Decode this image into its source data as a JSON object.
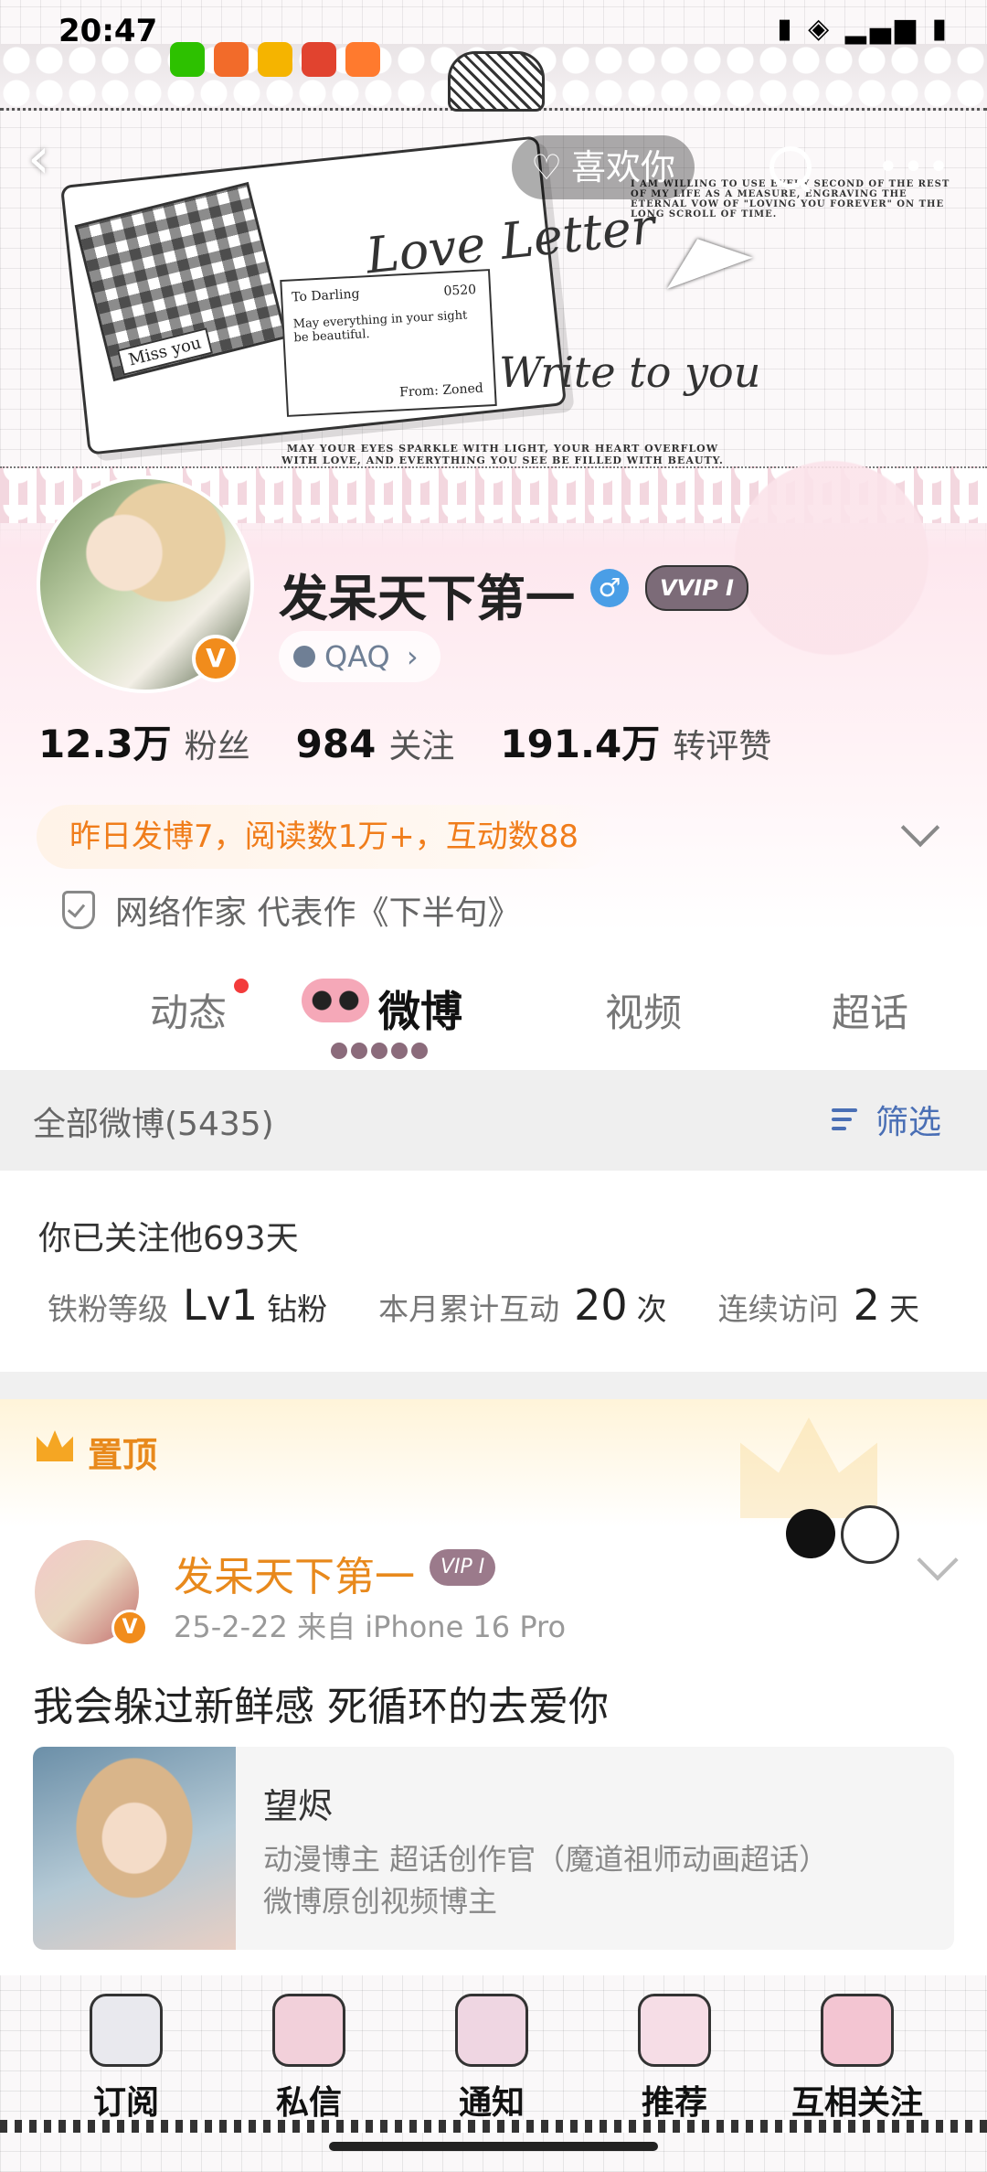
{
  "status_bar": {
    "time": "20:47",
    "system": "▮ ◈ ▂▄▆ ▮"
  },
  "header": {
    "like_label": "喜欢你",
    "banner": {
      "love_letter": "Love Letter",
      "write_to_you": "Write to you",
      "letter_to": "To Darling",
      "letter_date": "0520",
      "letter_body": "May everything in your sight be beautiful.",
      "letter_from": "From: Zoned",
      "miss_you": "Miss you",
      "slogan_bottom": "MAY YOUR EYES SPARKLE WITH LIGHT, YOUR HEART OVERFLOW WITH LOVE, AND EVERYTHING YOU SEE BE FILLED WITH BEAUTY.",
      "slogan_top": "I AM WILLING TO USE EVERY SECOND OF THE REST OF MY LIFE AS A MEASURE, ENGRAVING THE ETERNAL VOW OF \"LOVING YOU FOREVER\" ON THE LONG SCROLL OF TIME."
    }
  },
  "profile": {
    "nickname": "发呆天下第一",
    "gender_symbol": "♂",
    "vip_label": "VVIP I",
    "verify_badge": "V",
    "tag": "QAQ",
    "tag_arrow": "›",
    "stats": [
      {
        "value": "12.3万",
        "label": "粉丝"
      },
      {
        "value": "984",
        "label": "关注"
      },
      {
        "value": "191.4万",
        "label": "转评赞"
      }
    ],
    "activity": "昨日发博7，阅读数1万+，互动数88",
    "author_desc": "网络作家 代表作《下半句》"
  },
  "tabs": [
    {
      "label": "动态"
    },
    {
      "label": "微博"
    },
    {
      "label": "视频"
    },
    {
      "label": "超话"
    }
  ],
  "list": {
    "title": "全部微博(5435)",
    "filter_label": "筛选"
  },
  "fan_card": {
    "followed": "你已关注他693天",
    "items": [
      {
        "label": "铁粉等级",
        "value": "Lv1",
        "unit": "钻粉"
      },
      {
        "label": "本月累计互动",
        "value": "20",
        "unit": "次"
      },
      {
        "label": "连续访问",
        "value": "2",
        "unit": "天"
      }
    ]
  },
  "pinned_post": {
    "pin_label": "置顶",
    "author": "发呆天下第一",
    "vip_label": "VIP I",
    "meta": "25-2-22   来自 iPhone 16 Pro",
    "text": "我会躲过新鲜感 死循环的去爱你",
    "share": {
      "title": "望烬",
      "line1": "动漫博主 超话创作官（魔道祖师动画超话）",
      "line2": "微博原创视频博主"
    }
  },
  "bottom_nav": [
    {
      "label": "订阅",
      "icon": "gift-box-icon",
      "color": "#e9e9ee"
    },
    {
      "label": "私信",
      "icon": "bow-icon",
      "color": "#f2d0da"
    },
    {
      "label": "通知",
      "icon": "bell-icon",
      "color": "#efd6e2"
    },
    {
      "label": "推荐",
      "icon": "bag-icon",
      "color": "#f6dde6"
    },
    {
      "label": "互相关注",
      "icon": "cake-icon",
      "color": "#f3c5d2"
    }
  ],
  "colors": {
    "accent_orange": "#f07d1b",
    "link_blue": "#4a6fb5",
    "badge_red": "#f33b3b"
  }
}
